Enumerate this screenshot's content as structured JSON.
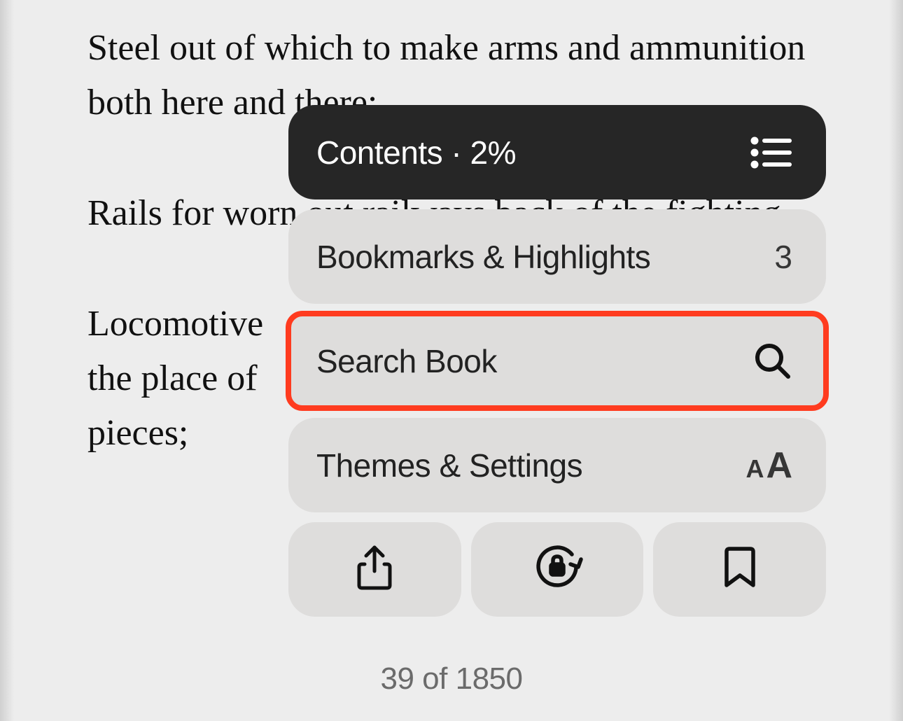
{
  "reader": {
    "paragraph1": "Steel out of which to make arms and ammunition both here and there;",
    "paragraph2": "Rails for worn out railways back of the fighting",
    "paragraph3": "Locomotive                                          the place of                                    pieces;"
  },
  "menu": {
    "contents": {
      "label": "Contents · 2%"
    },
    "bookmarks": {
      "label": "Bookmarks & Highlights",
      "count": "3"
    },
    "search": {
      "label": "Search Book"
    },
    "themes": {
      "label": "Themes & Settings"
    }
  },
  "footer": {
    "pagination": "39 of 1850"
  }
}
